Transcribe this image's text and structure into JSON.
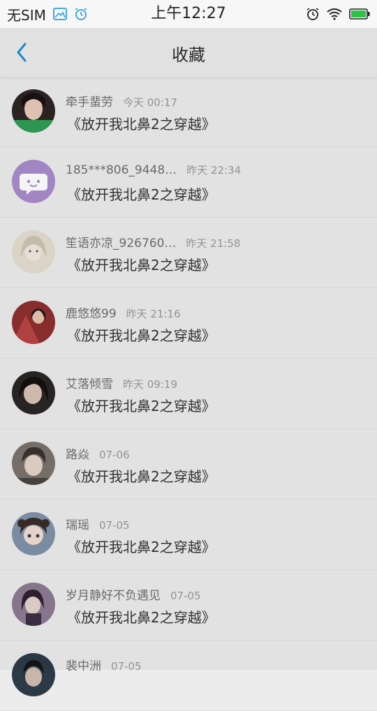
{
  "status_bar": {
    "carrier": "无SIM",
    "time": "上午12:27"
  },
  "header": {
    "title": "收藏"
  },
  "items": [
    {
      "name": "牵手蜚劳",
      "time": "今天 00:17",
      "book": "《放开我北鼻2之穿越》",
      "avatar_color": "#3a2f2f"
    },
    {
      "name": "185***806_9448…",
      "time": "昨天 22:34",
      "book": "《放开我北鼻2之穿越》",
      "avatar_color": "#a88bc8"
    },
    {
      "name": "笙语亦凉_926760…",
      "time": "昨天 21:58",
      "book": "《放开我北鼻2之穿越》",
      "avatar_color": "#d9d2c2"
    },
    {
      "name": "鹿悠悠99",
      "time": "昨天 21:16",
      "book": "《放开我北鼻2之穿越》",
      "avatar_color": "#9b3a3a"
    },
    {
      "name": "艾落倾雪",
      "time": "昨天 09:19",
      "book": "《放开我北鼻2之穿越》",
      "avatar_color": "#2e2a2a"
    },
    {
      "name": "路焱",
      "time": "07-06",
      "book": "《放开我北鼻2之穿越》",
      "avatar_color": "#6f6a66"
    },
    {
      "name": "瑞瑶",
      "time": "07-05",
      "book": "《放开我北鼻2之穿越》",
      "avatar_color": "#5e6d80"
    },
    {
      "name": "岁月静好不负遇见",
      "time": "07-05",
      "book": "《放开我北鼻2之穿越》",
      "avatar_color": "#6b5a6f"
    },
    {
      "name": "裴中洲",
      "time": "07-05",
      "book": "",
      "avatar_color": "#2c3a48"
    }
  ]
}
